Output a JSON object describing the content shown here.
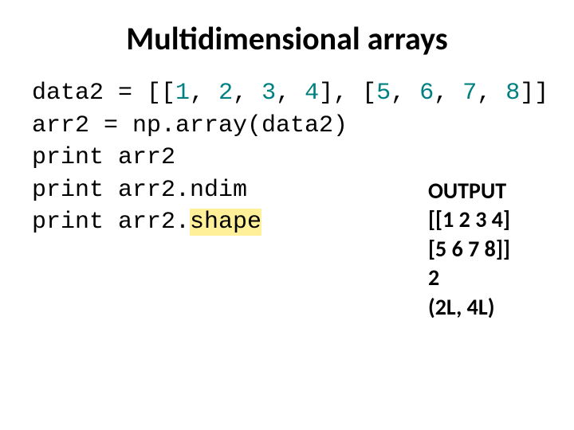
{
  "title": "Multidimensional arrays",
  "code": {
    "l1_pre": "data2 = [[",
    "l1_n1": "1",
    "l1_c1": ", ",
    "l1_n2": "2",
    "l1_c2": ", ",
    "l1_n3": "3",
    "l1_c3": ", ",
    "l1_n4": "4",
    "l1_mid": "], [",
    "l1_n5": "5",
    "l1_c5": ", ",
    "l1_n6": "6",
    "l1_c6": ", ",
    "l1_n7": "7",
    "l1_c7": ", ",
    "l1_n8": "8",
    "l1_post": "]]",
    "l2": "arr2 = np.array(data2)",
    "l3_kw": "print",
    "l3_rest": " arr2",
    "l4_kw": "print",
    "l4_rest": " arr2.ndim",
    "l5_kw": "print",
    "l5_a": " arr2.",
    "l5_hl": "shape"
  },
  "output": {
    "heading": "OUTPUT",
    "line1": "[[1 2 3 4]",
    "line2": " [5 6 7 8]]",
    "line3": "2",
    "line4": "(2L, 4L)"
  }
}
